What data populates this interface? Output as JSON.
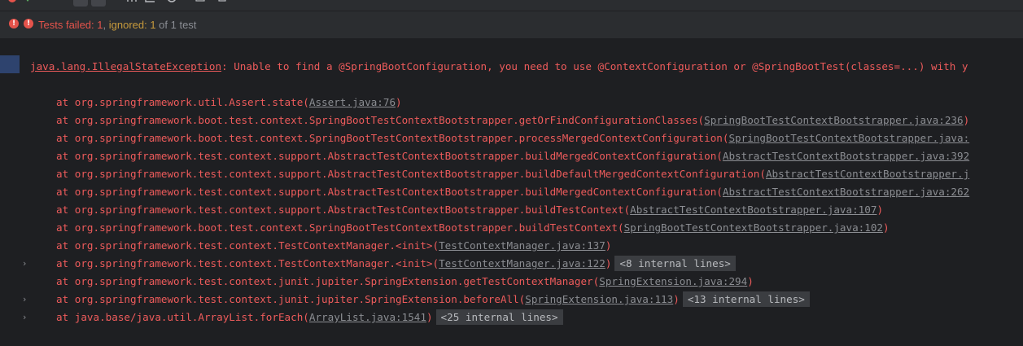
{
  "status": {
    "failed_label": "Tests failed: ",
    "failed_count": "1",
    "separator": ", ",
    "ignored_label": "ignored: ",
    "ignored_count": "1",
    "of_text": " of 1 test"
  },
  "exception": {
    "class_name": "java.lang.IllegalStateException",
    "message": ": Unable to find a @SpringBootConfiguration, you need to use @ContextConfiguration or @SpringBootTest(classes=...) with y"
  },
  "frames": [
    {
      "text": "at org.springframework.util.Assert.state(",
      "link": "Assert.java:76",
      "close": ")",
      "internal": ""
    },
    {
      "text": "at org.springframework.boot.test.context.SpringBootTestContextBootstrapper.getOrFindConfigurationClasses(",
      "link": "SpringBootTestContextBootstrapper.java:236",
      "close": ")",
      "internal": ""
    },
    {
      "text": "at org.springframework.boot.test.context.SpringBootTestContextBootstrapper.processMergedContextConfiguration(",
      "link": "SpringBootTestContextBootstrapper.java:",
      "close": "",
      "internal": ""
    },
    {
      "text": "at org.springframework.test.context.support.AbstractTestContextBootstrapper.buildMergedContextConfiguration(",
      "link": "AbstractTestContextBootstrapper.java:392",
      "close": "",
      "internal": ""
    },
    {
      "text": "at org.springframework.test.context.support.AbstractTestContextBootstrapper.buildDefaultMergedContextConfiguration(",
      "link": "AbstractTestContextBootstrapper.j",
      "close": "",
      "internal": ""
    },
    {
      "text": "at org.springframework.test.context.support.AbstractTestContextBootstrapper.buildMergedContextConfiguration(",
      "link": "AbstractTestContextBootstrapper.java:262",
      "close": "",
      "internal": ""
    },
    {
      "text": "at org.springframework.test.context.support.AbstractTestContextBootstrapper.buildTestContext(",
      "link": "AbstractTestContextBootstrapper.java:107",
      "close": ")",
      "internal": ""
    },
    {
      "text": "at org.springframework.boot.test.context.SpringBootTestContextBootstrapper.buildTestContext(",
      "link": "SpringBootTestContextBootstrapper.java:102",
      "close": ")",
      "internal": ""
    },
    {
      "text": "at org.springframework.test.context.TestContextManager.<init>(",
      "link": "TestContextManager.java:137",
      "close": ")",
      "internal": ""
    },
    {
      "text": "at org.springframework.test.context.TestContextManager.<init>(",
      "link": "TestContextManager.java:122",
      "close": ")",
      "internal": "<8 internal lines>"
    },
    {
      "text": "at org.springframework.test.context.junit.jupiter.SpringExtension.getTestContextManager(",
      "link": "SpringExtension.java:294",
      "close": ")",
      "internal": ""
    },
    {
      "text": "at org.springframework.test.context.junit.jupiter.SpringExtension.beforeAll(",
      "link": "SpringExtension.java:113",
      "close": ")",
      "internal": "<13 internal lines>"
    },
    {
      "text": "at java.base/java.util.ArrayList.forEach(",
      "link": "ArrayList.java:1541",
      "close": ")",
      "internal": "<25 internal lines>"
    }
  ],
  "colors": {
    "error": "#e5534b",
    "ignored": "#c79a3c",
    "stack_text": "#ed5b5b",
    "link": "#8b8d92",
    "background": "#1e1f22"
  },
  "icons": [
    "error-icon",
    "chevron-right-icon"
  ]
}
